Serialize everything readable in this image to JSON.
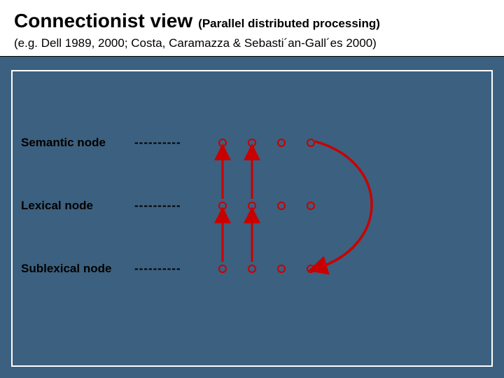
{
  "header": {
    "title": "Connectionist view",
    "subtitle": "(Parallel distributed processing)",
    "citation": "(e.g. Dell 1989, 2000; Costa, Caramazza & Sebasti´an-Gall´es 2000)"
  },
  "diagram": {
    "rows": [
      {
        "label": "Semantic node",
        "dashes": "----------"
      },
      {
        "label": "Lexical node",
        "dashes": "----------"
      },
      {
        "label": "Sublexical node",
        "dashes": "----------"
      }
    ],
    "connections": [
      {
        "from": "lexical-node-1",
        "to": "semantic-node-1",
        "style": "straight"
      },
      {
        "from": "lexical-node-2",
        "to": "semantic-node-2",
        "style": "straight"
      },
      {
        "from": "sublexical-node-1",
        "to": "lexical-node-1",
        "style": "straight"
      },
      {
        "from": "sublexical-node-2",
        "to": "lexical-node-2",
        "style": "straight"
      },
      {
        "from": "semantic-node-4",
        "to": "sublexical-node-4",
        "style": "curve"
      }
    ],
    "colors": {
      "node_border": "#c80000",
      "arrow": "#c80000",
      "frame": "#ffffff",
      "text": "#000000"
    }
  }
}
